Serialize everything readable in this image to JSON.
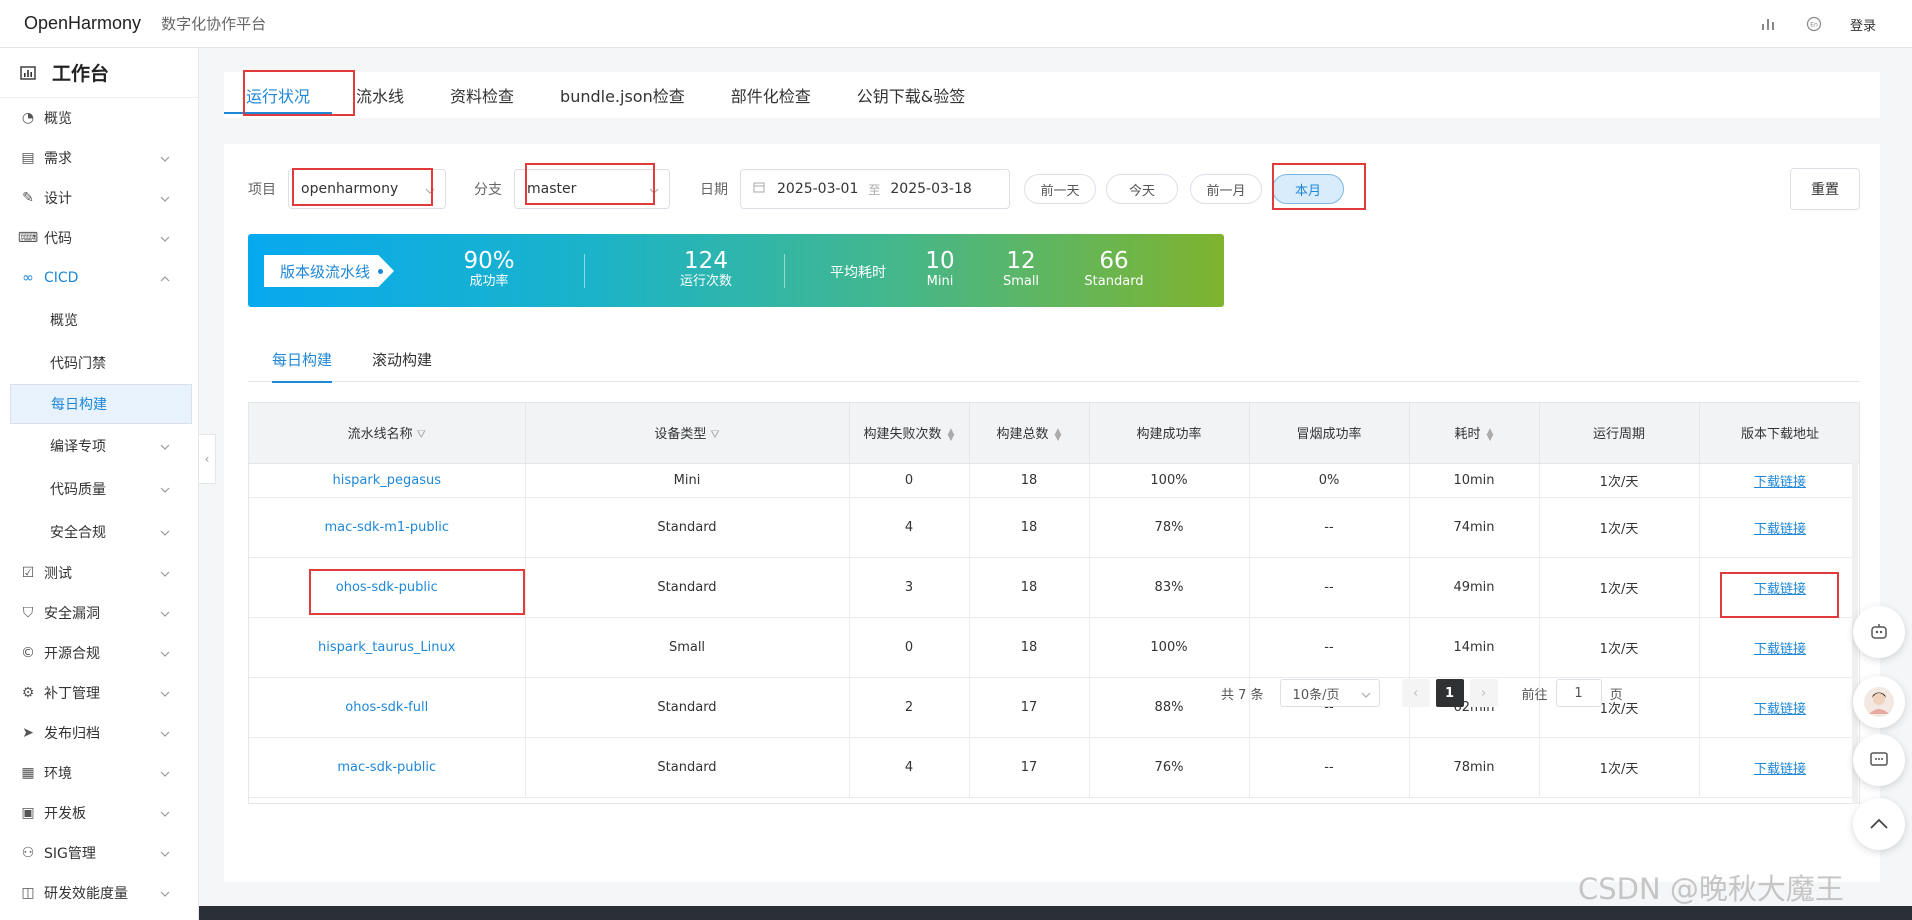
{
  "header": {
    "logo": "OpenHarmony",
    "subtitle": "数字化协作平台",
    "login": "登录"
  },
  "sidebar": {
    "workspace": "工作台",
    "items": [
      {
        "label": "概览",
        "icon": "dashboard-icon"
      },
      {
        "label": "需求",
        "icon": "requirement-icon"
      },
      {
        "label": "设计",
        "icon": "design-icon"
      },
      {
        "label": "代码",
        "icon": "code-icon"
      },
      {
        "label": "CICD",
        "icon": "cicd-icon"
      },
      {
        "label": "测试",
        "icon": "test-icon"
      },
      {
        "label": "安全漏洞",
        "icon": "shield-icon"
      },
      {
        "label": "开源合规",
        "icon": "copyright-icon"
      },
      {
        "label": "补丁管理",
        "icon": "patch-icon"
      },
      {
        "label": "发布归档",
        "icon": "send-icon"
      },
      {
        "label": "环境",
        "icon": "env-icon"
      },
      {
        "label": "开发板",
        "icon": "board-icon"
      },
      {
        "label": "SIG管理",
        "icon": "sig-icon"
      },
      {
        "label": "研发效能度量",
        "icon": "metrics-icon"
      }
    ],
    "cicd_sub": [
      "概览",
      "代码门禁",
      "每日构建",
      "编译专项",
      "代码质量",
      "安全合规"
    ]
  },
  "tabs": [
    "运行状况",
    "流水线",
    "资料检查",
    "bundle.json检查",
    "部件化检查",
    "公钥下载&验签"
  ],
  "filters": {
    "project_label": "项目",
    "project_value": "openharmony",
    "branch_label": "分支",
    "branch_value": "master",
    "date_label": "日期",
    "date_start": "2025-03-01",
    "date_sep": "至",
    "date_end": "2025-03-18",
    "btn_prev_day": "前一天",
    "btn_today": "今天",
    "btn_prev_month": "前一月",
    "btn_this_month": "本月",
    "reset": "重置"
  },
  "banner": {
    "tag": "版本级流水线",
    "success_rate": "90%",
    "success_rate_label": "成功率",
    "runs": "124",
    "runs_label": "运行次数",
    "avg_label": "平均耗时",
    "mini": "10",
    "mini_label": "Mini",
    "small": "12",
    "small_label": "Small",
    "standard": "66",
    "standard_label": "Standard"
  },
  "subtabs": [
    "每日构建",
    "滚动构建"
  ],
  "table": {
    "headers": [
      "流水线名称",
      "设备类型",
      "构建失败次数",
      "构建总数",
      "构建成功率",
      "冒烟成功率",
      "耗时",
      "运行周期",
      "版本下载地址"
    ],
    "rows": [
      [
        "hispark_pegasus",
        "Mini",
        "0",
        "18",
        "100%",
        "0%",
        "10min",
        "1次/天",
        "下载链接"
      ],
      [
        "mac-sdk-m1-public",
        "Standard",
        "4",
        "18",
        "78%",
        "--",
        "74min",
        "1次/天",
        "下载链接"
      ],
      [
        "ohos-sdk-public",
        "Standard",
        "3",
        "18",
        "83%",
        "--",
        "49min",
        "1次/天",
        "下载链接"
      ],
      [
        "hispark_taurus_Linux",
        "Small",
        "0",
        "18",
        "100%",
        "--",
        "14min",
        "1次/天",
        "下载链接"
      ],
      [
        "ohos-sdk-full",
        "Standard",
        "2",
        "17",
        "88%",
        "--",
        "62min",
        "1次/天",
        "下载链接"
      ],
      [
        "mac-sdk-public",
        "Standard",
        "4",
        "17",
        "76%",
        "--",
        "78min",
        "1次/天",
        "下载链接"
      ]
    ]
  },
  "pagination": {
    "total": "共 7 条",
    "page_size": "10条/页",
    "current": "1",
    "goto_label": "前往",
    "goto_value": "1",
    "page_suffix": "页"
  },
  "watermark": "CSDN @晚秋大魔王",
  "colors": {
    "accent": "#1f87d8",
    "highlight_box": "#e23b3b"
  }
}
